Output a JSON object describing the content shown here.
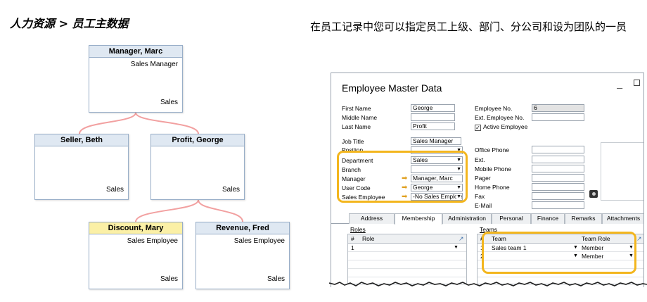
{
  "page": {
    "title": "人力资源 > 员工主数据",
    "description": "在员工记录中您可以指定员工上级、部门、分公司和设为团队的一员"
  },
  "org_chart": {
    "nodes": [
      {
        "name": "Manager, Marc",
        "role": "Sales Manager",
        "dept": "Sales"
      },
      {
        "name": "Seller, Beth",
        "role": "",
        "dept": "Sales"
      },
      {
        "name": "Profit, George",
        "role": "",
        "dept": "Sales"
      },
      {
        "name": "Discount, Mary",
        "role": "Sales Employee",
        "dept": "Sales"
      },
      {
        "name": "Revenue, Fred",
        "role": "Sales Employee",
        "dept": "Sales"
      }
    ]
  },
  "window": {
    "title": "Employee Master Data",
    "minimize": "_",
    "labels": {
      "first_name": "First Name",
      "middle_name": "Middle Name",
      "last_name": "Last Name",
      "job_title": "Job Title",
      "position": "Position",
      "department": "Department",
      "branch": "Branch",
      "manager": "Manager",
      "user_code": "User Code",
      "sales_employee": "Sales Employee",
      "employee_no": "Employee No.",
      "ext_employee_no": "Ext. Employee No.",
      "active_employee": "Active Employee",
      "office_phone": "Office Phone",
      "ext": "Ext.",
      "mobile_phone": "Mobile Phone",
      "pager": "Pager",
      "home_phone": "Home Phone",
      "fax": "Fax",
      "email": "E-Mail"
    },
    "values": {
      "first_name": "George",
      "middle_name": "",
      "last_name": "Profit",
      "job_title": "Sales Manager",
      "position": "",
      "department": "Sales",
      "branch": "",
      "manager": "Manager, Marc",
      "user_code": "George",
      "sales_employee": "-No Sales Employee-",
      "employee_no": "6",
      "ext_employee_no": "",
      "active_employee_checked": true,
      "office_phone": "",
      "ext": "",
      "mobile_phone": "",
      "pager": "",
      "home_phone": "",
      "fax": "",
      "email": ""
    },
    "tabs": [
      "Address",
      "Membership",
      "Administration",
      "Personal",
      "Finance",
      "Remarks",
      "Attachments"
    ],
    "active_tab": "Membership",
    "roles": {
      "title": "Roles",
      "columns": [
        "#",
        "Role"
      ],
      "rows": [
        {
          "num": "1",
          "role": ""
        }
      ]
    },
    "teams": {
      "title": "Teams",
      "columns": [
        "#",
        "Team",
        "Team Role"
      ],
      "rows": [
        {
          "num": "1",
          "team": "Sales team 1",
          "team_role": "Member"
        },
        {
          "num": "2",
          "team": "",
          "team_role": "Member"
        }
      ]
    }
  },
  "colors": {
    "highlight": "#f3b61e",
    "org_header": "#dfe8f2",
    "org_highlight_header": "#fbf0a6",
    "connector": "#f2a0a0"
  }
}
